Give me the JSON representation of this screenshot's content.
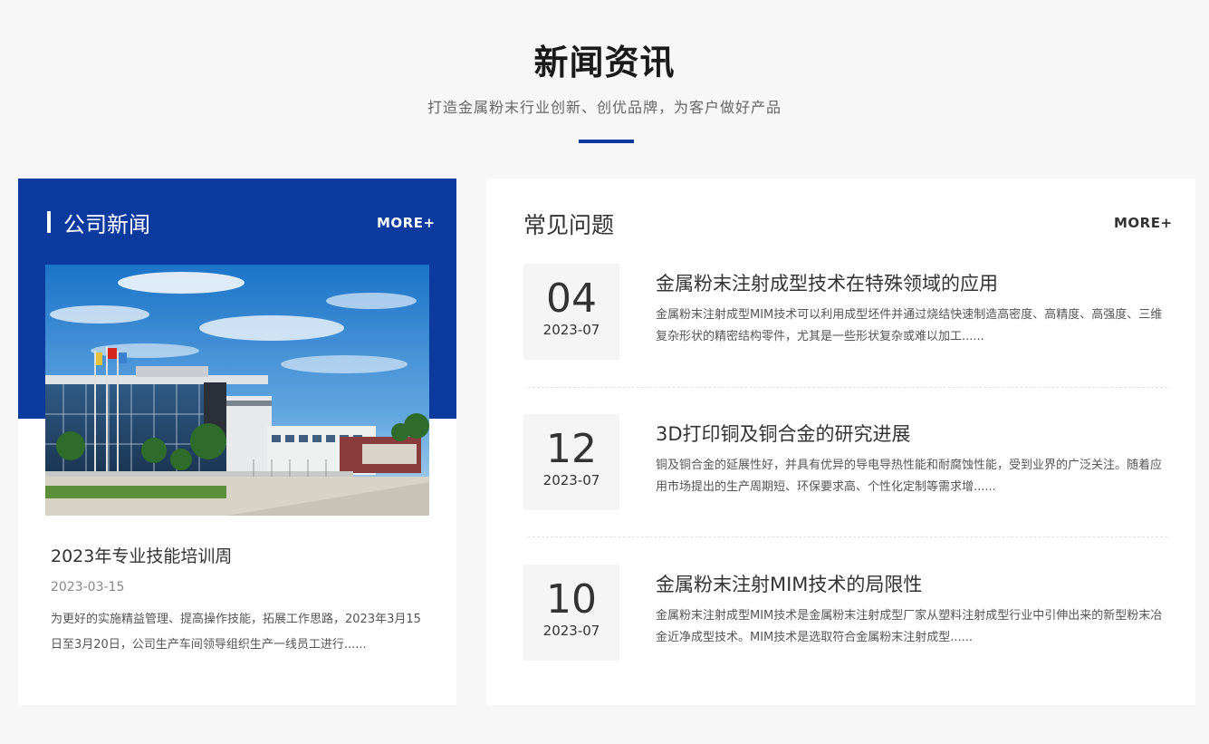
{
  "section": {
    "title": "新闻资讯",
    "subtitle": "打造金属粉末行业创新、创优品牌，为客户做好产品"
  },
  "company_news": {
    "heading": "公司新闻",
    "more_label": "MORE+",
    "article": {
      "title": "2023年专业技能培训周",
      "date": "2023-03-15",
      "excerpt": "为更好的实施精益管理、提高操作技能，拓展工作思路，2023年3月15日至3月20日，公司生产车间领导组织生产一线员工进行......"
    }
  },
  "faq": {
    "heading": "常见问题",
    "more_label": "MORE+",
    "items": [
      {
        "day": "04",
        "year_month": "2023-07",
        "title": "金属粉末注射成型技术在特殊领域的应用",
        "excerpt": "金属粉末注射成型MIM技术可以利用成型坯件并通过烧结快速制造高密度、高精度、高强度、三维复杂形状的精密结构零件，尤其是一些形状复杂或难以加工......"
      },
      {
        "day": "12",
        "year_month": "2023-07",
        "title": "3D打印铜及铜合金的研究进展",
        "excerpt": "铜及铜合金的延展性好，并具有优异的导电导热性能和耐腐蚀性能，受到业界的广泛关注。随着应用市场提出的生产周期短、环保要求高、个性化定制等需求增......"
      },
      {
        "day": "10",
        "year_month": "2023-07",
        "title": "金属粉末注射MIM技术的局限性",
        "excerpt": "金属粉末注射成型MIM技术是金属粉末注射成型厂家从塑料注射成型行业中引伸出来的新型粉末冶金近净成型技术。MIM技术是选取符合金属粉末注射成型......"
      }
    ]
  },
  "colors": {
    "brand_blue": "#0d3a9e",
    "background": "#f7f7f7",
    "card": "#ffffff"
  }
}
